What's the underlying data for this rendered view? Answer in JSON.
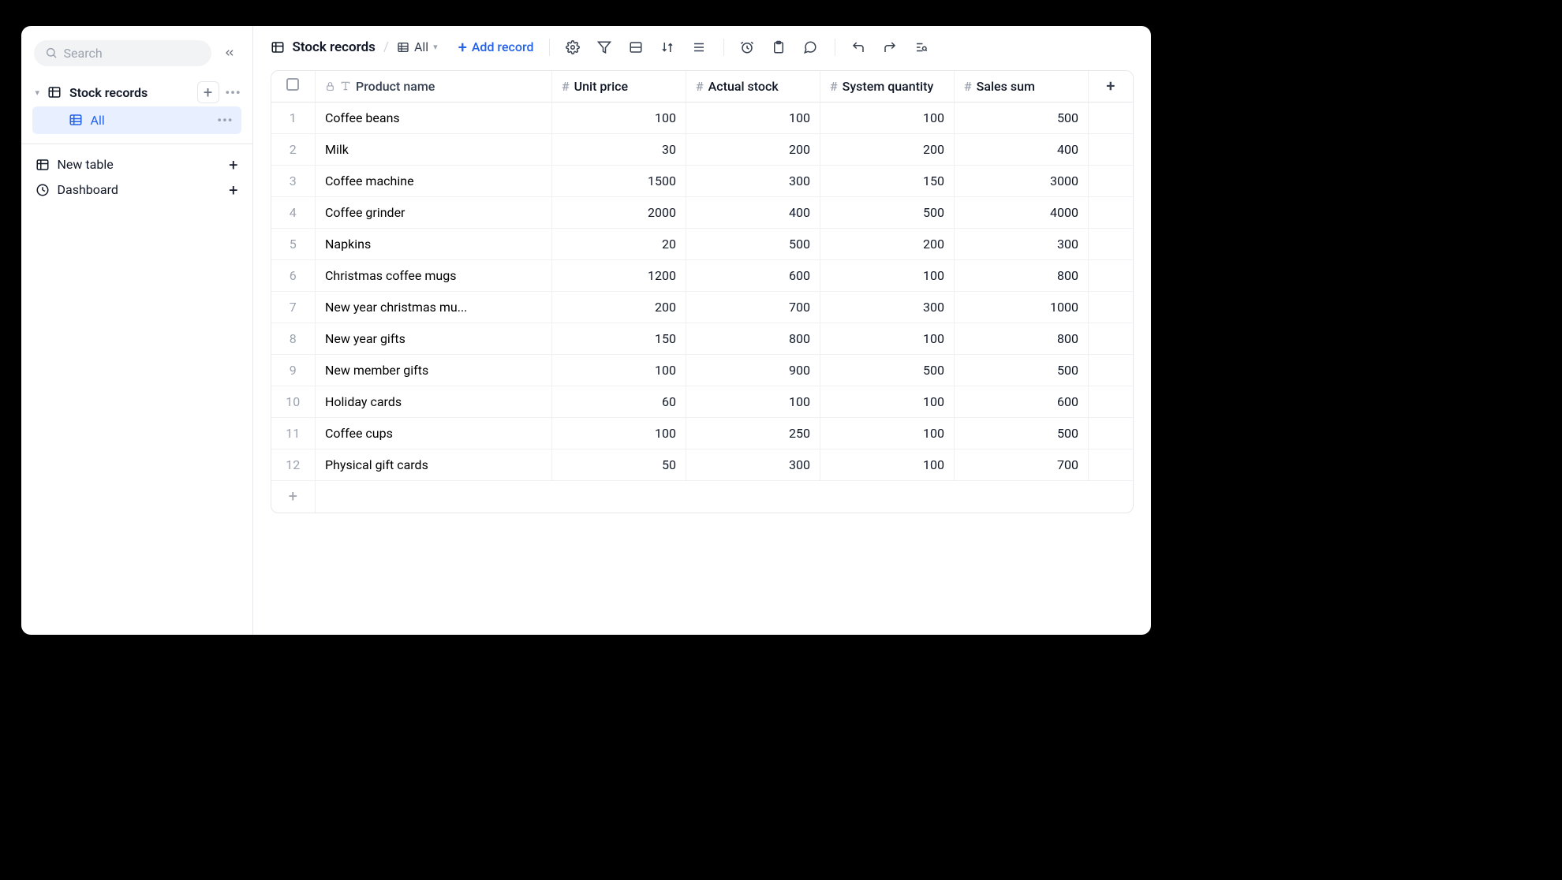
{
  "sidebar": {
    "search_placeholder": "Search",
    "items": [
      {
        "label": "Stock records",
        "icon": "table"
      }
    ],
    "views": [
      {
        "label": "All"
      }
    ],
    "new_table_label": "New table",
    "dashboard_label": "Dashboard"
  },
  "toolbar": {
    "breadcrumb_table": "Stock records",
    "view_label": "All",
    "add_record_label": "Add record"
  },
  "table": {
    "columns": [
      {
        "key": "product_name",
        "label": "Product name",
        "type": "text"
      },
      {
        "key": "unit_price",
        "label": "Unit price",
        "type": "number"
      },
      {
        "key": "actual_stock",
        "label": "Actual stock",
        "type": "number"
      },
      {
        "key": "system_quantity",
        "label": "System quantity",
        "type": "number"
      },
      {
        "key": "sales_sum",
        "label": "Sales sum",
        "type": "number"
      }
    ],
    "rows": [
      {
        "idx": "1",
        "product_name": "Coffee beans",
        "unit_price": "100",
        "actual_stock": "100",
        "system_quantity": "100",
        "sales_sum": "500"
      },
      {
        "idx": "2",
        "product_name": "Milk",
        "unit_price": "30",
        "actual_stock": "200",
        "system_quantity": "200",
        "sales_sum": "400"
      },
      {
        "idx": "3",
        "product_name": "Coffee machine",
        "unit_price": "1500",
        "actual_stock": "300",
        "system_quantity": "150",
        "sales_sum": "3000"
      },
      {
        "idx": "4",
        "product_name": "Coffee grinder",
        "unit_price": "2000",
        "actual_stock": "400",
        "system_quantity": "500",
        "sales_sum": "4000"
      },
      {
        "idx": "5",
        "product_name": "Napkins",
        "unit_price": "20",
        "actual_stock": "500",
        "system_quantity": "200",
        "sales_sum": "300"
      },
      {
        "idx": "6",
        "product_name": "Christmas coffee mugs",
        "unit_price": "1200",
        "actual_stock": "600",
        "system_quantity": "100",
        "sales_sum": "800"
      },
      {
        "idx": "7",
        "product_name": "New year christmas mu...",
        "unit_price": "200",
        "actual_stock": "700",
        "system_quantity": "300",
        "sales_sum": "1000"
      },
      {
        "idx": "8",
        "product_name": "New year gifts",
        "unit_price": "150",
        "actual_stock": "800",
        "system_quantity": "100",
        "sales_sum": "800"
      },
      {
        "idx": "9",
        "product_name": "New member gifts",
        "unit_price": "100",
        "actual_stock": "900",
        "system_quantity": "500",
        "sales_sum": "500"
      },
      {
        "idx": "10",
        "product_name": "Holiday cards",
        "unit_price": "60",
        "actual_stock": "100",
        "system_quantity": "100",
        "sales_sum": "600"
      },
      {
        "idx": "11",
        "product_name": "Coffee cups",
        "unit_price": "100",
        "actual_stock": "250",
        "system_quantity": "100",
        "sales_sum": "500"
      },
      {
        "idx": "12",
        "product_name": "Physical gift cards",
        "unit_price": "50",
        "actual_stock": "300",
        "system_quantity": "100",
        "sales_sum": "700"
      }
    ]
  }
}
